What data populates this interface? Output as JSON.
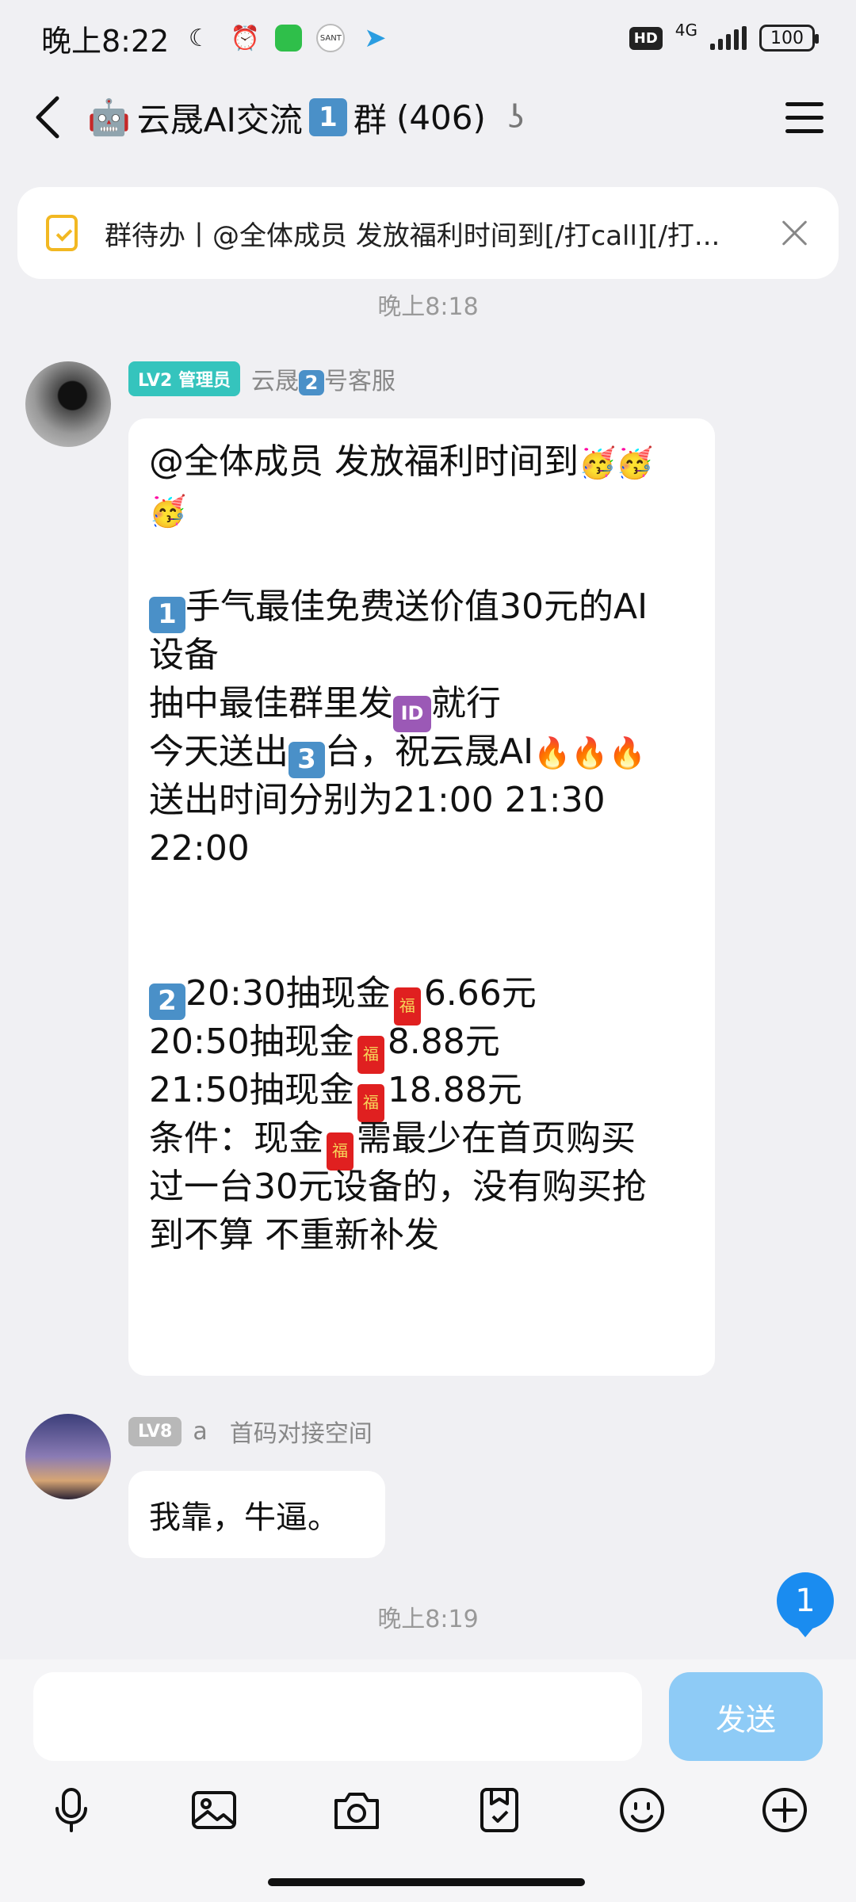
{
  "status_bar": {
    "time": "晚上8:22",
    "network": "4G",
    "battery": "100",
    "hd": "HD",
    "notification_text": "SANT"
  },
  "header": {
    "emoji": "🤖",
    "title_prefix": "云晟AI交流",
    "title_key": "1",
    "title_suffix": "群",
    "member_count": "(406)"
  },
  "todo_banner": {
    "text": "群待办丨@全体成员 发放福利时间到[/打call][/打..."
  },
  "timestamps": [
    "晚上8:18",
    "晚上8:19"
  ],
  "messages": [
    {
      "badge": "LV2 管理员",
      "sender_name_prefix": "云晟",
      "sender_key": "2",
      "sender_name_suffix": "号客服",
      "lines": {
        "l1": "@全体成员 发放福利时间到",
        "l3_text": "手气最佳免费送价值30元的AI",
        "l3_key": "1",
        "l4": "设备",
        "l5_prefix": "抽中最佳群里发",
        "l5_id": "ID",
        "l5_suffix": "就行",
        "l6_prefix": "今天送出",
        "l6_key": "3",
        "l6_suffix": "台，祝云晟AI",
        "l7": "送出时间分别为21:00 21:30",
        "l8": "22:00",
        "l11_key": "2",
        "l11_prefix": "20:30抽现金",
        "l11_amount": "6.66元",
        "l12_prefix": "20:50抽现金",
        "l12_amount": "8.88元",
        "l13_prefix": "21:50抽现金",
        "l13_amount": "18.88元",
        "l14_prefix": "条件：现金",
        "l14_suffix": "需最少在首页购买",
        "l15": "过一台30元设备的，没有购买抢",
        "l16": "到不算 不重新补发"
      },
      "emoji_party": "🥳",
      "emoji_fire": "🔥",
      "hongbao_glyph": "福"
    },
    {
      "badge": "LV8",
      "sender_name": "a",
      "sender_title": "首码对接空间",
      "text": "我靠，牛逼。"
    }
  ],
  "unread_count": "1",
  "input": {
    "placeholder": "",
    "send_label": "发送"
  },
  "toolbar": [
    "microphone-icon",
    "image-icon",
    "camera-icon",
    "sticker-icon",
    "emoji-icon",
    "plus-icon"
  ],
  "colors": {
    "background": "#f0f0f3",
    "admin_badge": "#35c4bd",
    "send_button": "#8ecbf6",
    "unread": "#1a8cf0",
    "todo_icon": "#f2b822"
  }
}
